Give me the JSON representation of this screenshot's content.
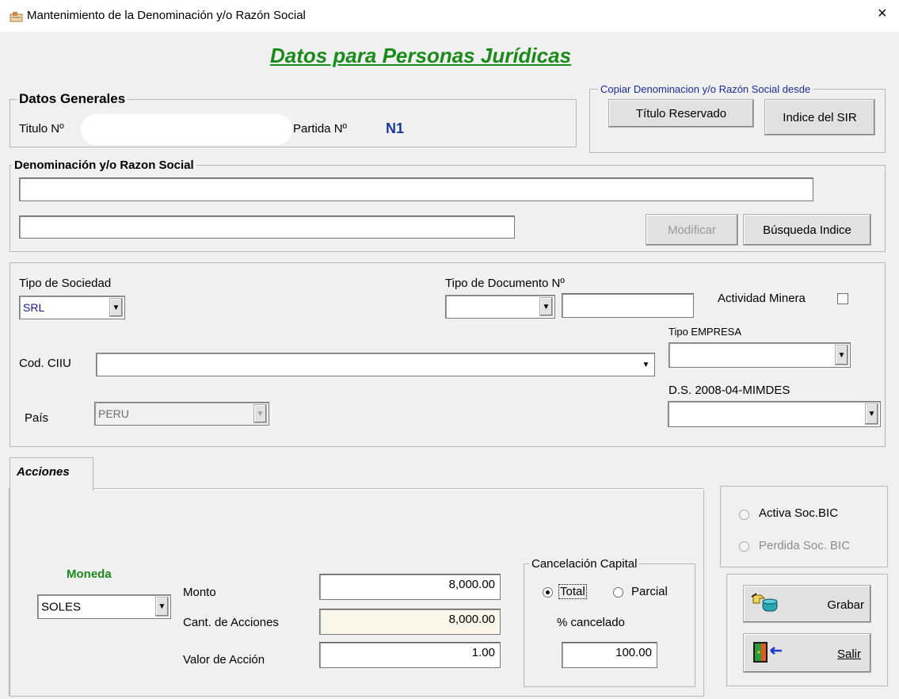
{
  "window": {
    "title": "Mantenimiento  de la Denominación y/o Razón Social",
    "close": "×"
  },
  "heading": "Datos para Personas Jurídicas",
  "datos_generales": {
    "legend": "Datos Generales",
    "titulo_label": "Titulo Nº",
    "partida_label": "Partida Nº",
    "partida_value": "N1"
  },
  "copiar": {
    "legend": "Copiar Denominacion y/o Razón Social desde",
    "titulo_reservado": "Título Reservado",
    "indice_sir": "Indice del SIR"
  },
  "denominacion": {
    "legend": "Denominación y/o Razon Social",
    "line1": "",
    "line2": "",
    "modificar": "Modificar",
    "busqueda": "Búsqueda Indice"
  },
  "sociedad": {
    "tipo_sociedad_label": "Tipo de Sociedad",
    "tipo_sociedad_value": "SRL",
    "tipo_documento_label": "Tipo de Documento Nº",
    "tipo_documento_value": "",
    "documento_numero": "",
    "actividad_minera_label": "Actividad Minera",
    "actividad_minera_checked": false,
    "tipo_empresa_label": "Tipo EMPRESA",
    "tipo_empresa_value": "",
    "ciiu_label": "Cod. CIIU",
    "ciiu_value": "",
    "ds_label": "D.S. 2008-04-MIMDES",
    "ds_value": "",
    "pais_label": "País",
    "pais_value": "PERU"
  },
  "acciones": {
    "tab_label": "Acciones",
    "moneda_label": "Moneda",
    "moneda_value": "SOLES",
    "monto_label": "Monto",
    "monto_value": "8,000.00",
    "cant_label": "Cant. de Acciones",
    "cant_value": "8,000.00",
    "valor_label": "Valor de Acción",
    "valor_value": "1.00",
    "cancelacion": {
      "legend": "Cancelación Capital",
      "total": "Total",
      "parcial": "Parcial",
      "selected": "Total",
      "pct_label": "% cancelado",
      "pct_value": "100.00"
    }
  },
  "bic": {
    "activa": "Activa Soc.BIC",
    "perdida": "Perdida Soc. BIC"
  },
  "actions": {
    "grabar": "Grabar",
    "salir": "Salir"
  },
  "colors": {
    "heading": "#1a8a1a",
    "partida": "#1a3a9a",
    "moneda": "#1a8a1a",
    "sociedad_value": "#1a1a8a"
  }
}
